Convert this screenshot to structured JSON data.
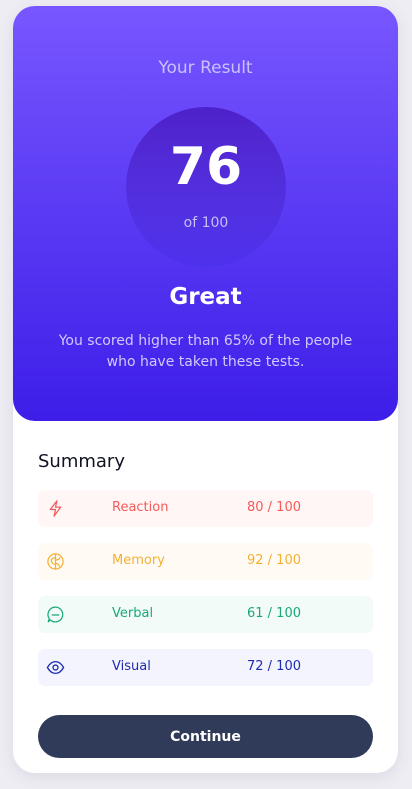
{
  "result": {
    "title": "Your Result",
    "score": "76",
    "total": "of 100",
    "rating": "Great",
    "message": "You scored higher than 65% of the people who have taken these tests."
  },
  "summary": {
    "title": "Summary",
    "items": [
      {
        "label": "Reaction",
        "score": "80 / 100",
        "icon": "lightning-icon",
        "color": "#f55a5a",
        "bg": "#fff6f5"
      },
      {
        "label": "Memory",
        "score": "92 / 100",
        "icon": "brain-icon",
        "color": "#f4b032",
        "bg": "#fffbf4"
      },
      {
        "label": "Verbal",
        "score": "61 / 100",
        "icon": "chat-bubble-icon",
        "color": "#19a87a",
        "bg": "#f2fbf8"
      },
      {
        "label": "Visual",
        "score": "72 / 100",
        "icon": "eye-icon",
        "color": "#1f2bae",
        "bg": "#f3f4fd"
      }
    ]
  },
  "continue_label": "Continue",
  "colors": {
    "gradient_top": "#7856ff",
    "gradient_bottom": "#3d1ee8",
    "button": "#303b5a"
  }
}
